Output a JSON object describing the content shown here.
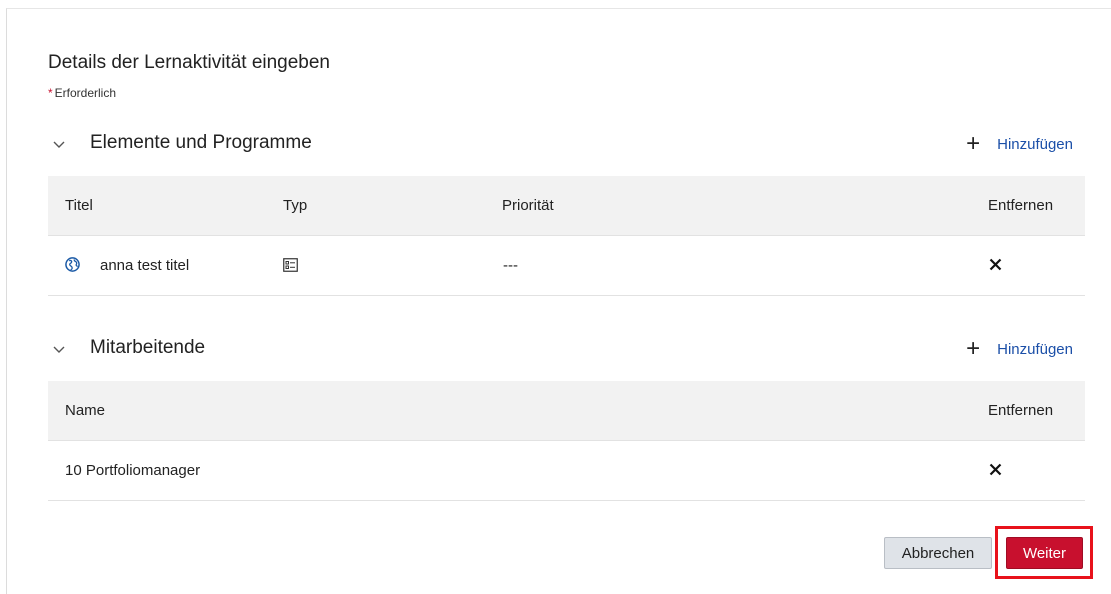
{
  "page": {
    "title": "Details der Lernaktivität eingeben",
    "required_asterisk": "*",
    "required_label": "Erforderlich"
  },
  "items_section": {
    "title": "Elemente und Programme",
    "add_label": "Hinzufügen",
    "columns": {
      "title": "Titel",
      "type": "Typ",
      "priority": "Priorität",
      "remove": "Entfernen"
    },
    "rows": [
      {
        "title": "anna test titel",
        "type_icon": "checklist-icon",
        "priority": "---"
      }
    ]
  },
  "employees_section": {
    "title": "Mitarbeitende",
    "add_label": "Hinzufügen",
    "columns": {
      "name": "Name",
      "remove": "Entfernen"
    },
    "rows": [
      {
        "name": "10 Portfoliomanager"
      }
    ]
  },
  "footer": {
    "cancel_label": "Abbrechen",
    "next_label": "Weiter"
  },
  "colors": {
    "primary_red": "#c8102e",
    "link_blue": "#1b4fa8",
    "highlight_red": "#e8121b",
    "header_gray": "#f2f2f2"
  }
}
